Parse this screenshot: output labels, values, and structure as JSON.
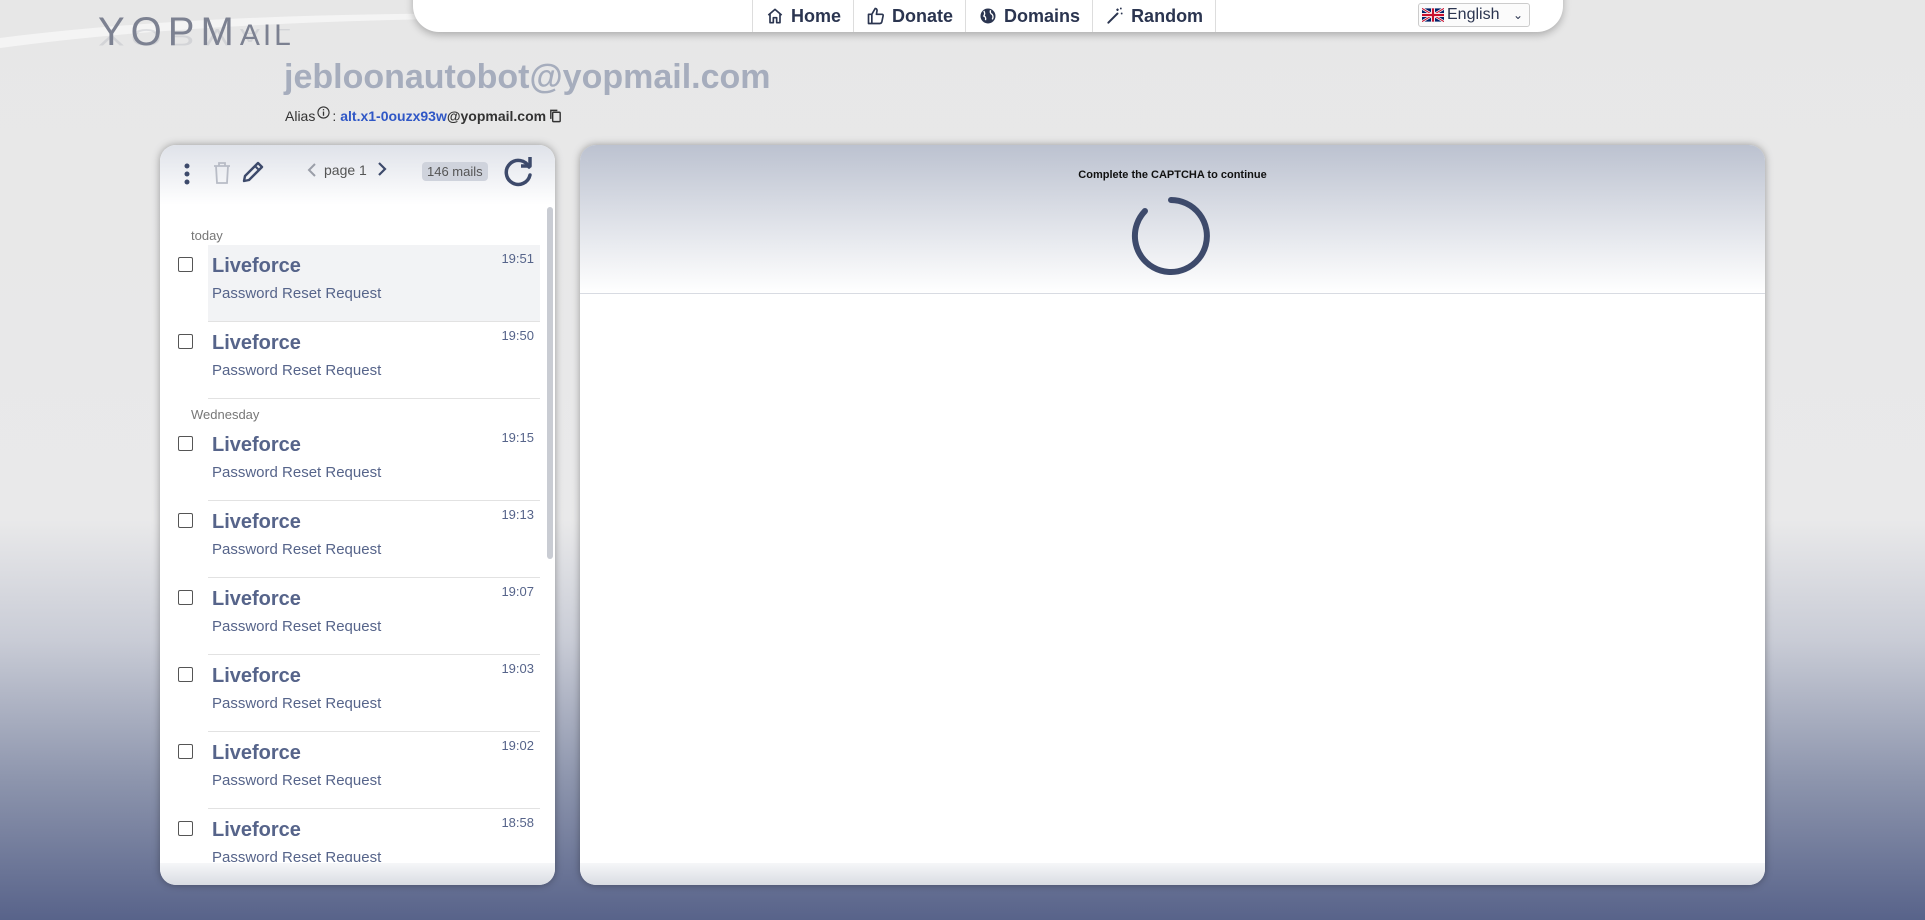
{
  "logo": {
    "text_a": "YOP",
    "text_b": "M",
    "text_c": "AIL"
  },
  "nav": {
    "items": [
      {
        "label": "Home",
        "icon": "home-icon"
      },
      {
        "label": "Donate",
        "icon": "thumbs-up-icon"
      },
      {
        "label": "Domains",
        "icon": "globe-icon"
      },
      {
        "label": "Random",
        "icon": "magic-wand-icon"
      }
    ],
    "language": "English"
  },
  "inbox": {
    "email": "jebloonautobot@yopmail.com",
    "alias_label": "Alias",
    "alias_sep": ":",
    "alias_name": "alt.x1-0ouzx93w",
    "alias_domain": "@yopmail.com"
  },
  "toolbar": {
    "page_label": "page 1",
    "count_label": "146 mails"
  },
  "mail_list": {
    "groups": [
      {
        "label": "today"
      },
      {
        "label": "Wednesday"
      }
    ],
    "items": [
      {
        "from": "Liveforce",
        "subject": "Password Reset Request",
        "time": "19:51"
      },
      {
        "from": "Liveforce",
        "subject": "Password Reset Request",
        "time": "19:50"
      },
      {
        "from": "Liveforce",
        "subject": "Password Reset Request",
        "time": "19:15"
      },
      {
        "from": "Liveforce",
        "subject": "Password Reset Request",
        "time": "19:13"
      },
      {
        "from": "Liveforce",
        "subject": "Password Reset Request",
        "time": "19:07"
      },
      {
        "from": "Liveforce",
        "subject": "Password Reset Request",
        "time": "19:03"
      },
      {
        "from": "Liveforce",
        "subject": "Password Reset Request",
        "time": "19:02"
      },
      {
        "from": "Liveforce",
        "subject": "Password Reset Request",
        "time": "18:58"
      }
    ]
  },
  "viewer": {
    "captcha_message": "Complete the CAPTCHA to continue"
  },
  "colors": {
    "accent": "#2f57c6",
    "mail_text": "#56648a",
    "nav_text": "#2b3550",
    "spinner": "#3d4a6b"
  }
}
